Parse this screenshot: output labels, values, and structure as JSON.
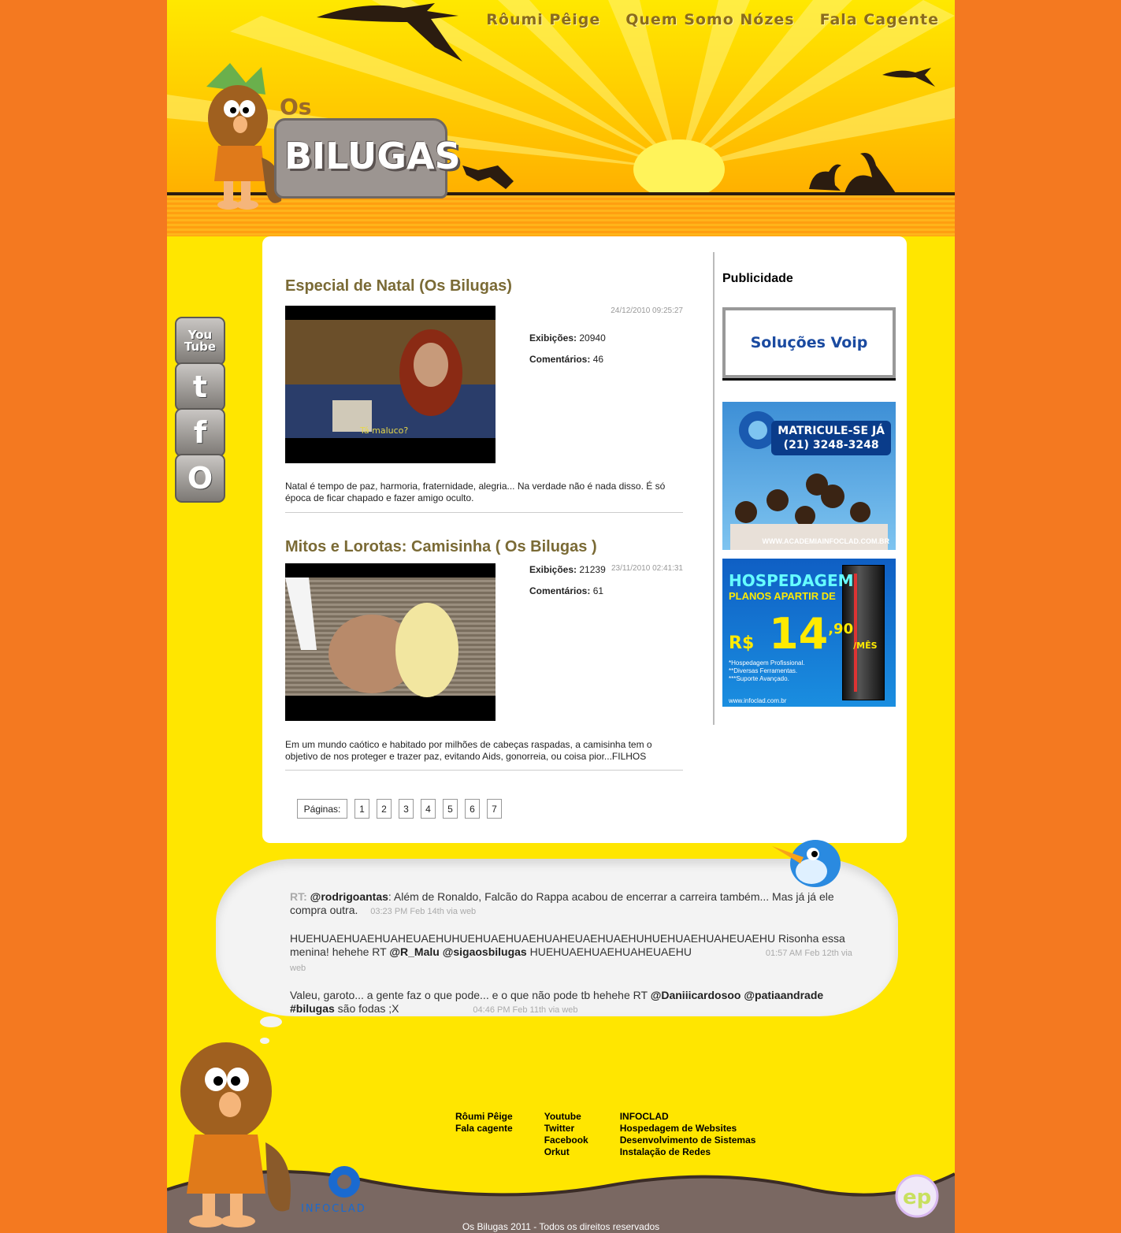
{
  "nav": [
    "Rôumi Pêige",
    "Quem Somo Nózes",
    "Fala Cagente"
  ],
  "logo": {
    "prefix": "Os",
    "name": "BILUGAS"
  },
  "social": [
    "YouTube",
    "Twitter",
    "Facebook",
    "Orkut"
  ],
  "posts": [
    {
      "title": "Especial de Natal (Os Bilugas)",
      "date": "24/12/2010 09:25:27",
      "views_label": "Exibições:",
      "views": "20940",
      "comments_label": "Comentários:",
      "comments": "46",
      "thumb_caption": "Tá maluco?",
      "description": "Natal é tempo de paz, harmoria, fraternidade, alegria... Na verdade não é nada disso. É só época de ficar chapado e fazer amigo oculto."
    },
    {
      "title": "Mitos e Lorotas: Camisinha ( Os Bilugas )",
      "date": "23/11/2010 02:41:31",
      "views_label": "Exibições:",
      "views": "21239",
      "comments_label": "Comentários:",
      "comments": "61",
      "description": "Em um mundo caótico e habitado por milhões de cabeças raspadas, a camisinha tem o objetivo de nos proteger e trazer paz, evitando Aids, gonorreia, ou coisa pior...FILHOS"
    }
  ],
  "pagination": {
    "label": "Páginas:",
    "pages": [
      "1",
      "2",
      "3",
      "4",
      "5",
      "6",
      "7"
    ]
  },
  "sidebar": {
    "title": "Publicidade",
    "voip": "Soluções Voip",
    "infoclad": {
      "line1": "MATRICULE-SE JÁ",
      "line2": "(21) 3248-3248",
      "url": "WWW.ACADEMIAINFOCLAD.COM.BR"
    },
    "host": {
      "title": "HOSPEDAGEM",
      "subtitle": "PLANOS APARTIR DE",
      "currency": "R$",
      "price": "14",
      "cents": ",90",
      "per": "/MÊS",
      "features": [
        "*Hospedagem Profissional.",
        "**Diversas Ferramentas.",
        "***Suporte Avançado."
      ],
      "url": "www.infoclad.com.br"
    }
  },
  "tweets": [
    {
      "prefix": "RT:",
      "user": "@rodrigoantas",
      "text": ": Além de Ronaldo, Falcão do Rappa acabou de encerrar a carreira também... Mas já já ele compra outra.",
      "meta": "03:23 PM Feb 14th via web"
    },
    {
      "text_before": "HUEHUAEHUAEHUAHEUAEHUHUEHUAEHUAEHUAHEUAEHUAEHUHUEHUAEHUAHEUAEHU Risonha essa menina! hehehe RT",
      "user1": "@R_Malu",
      "user2": "@sigaosbilugas",
      "text_after": " HUEHUAEHUAEHUAHEUAEHU",
      "meta": "01:57 AM Feb 12th via web"
    },
    {
      "text_before": "Valeu, garoto... a gente faz o que pode... e o que não pode tb hehehe RT",
      "user1": "@Daniiicardosoo",
      "user2": "@patiaandrade",
      "hashtag": "#bilugas",
      "text_after": " são fodas ;X",
      "meta": "04:46 PM Feb 11th via web"
    }
  ],
  "footer": {
    "col1": [
      "Rôumi Pêige",
      "Fala cagente"
    ],
    "col2": [
      "Youtube",
      "Twitter",
      "Facebook",
      "Orkut"
    ],
    "col3": [
      "INFOCLAD",
      "Hospedagem de Websites",
      "Desenvolvimento de Sistemas",
      "Instalação de Redes"
    ],
    "infoclad_logo": "INFOCLAD",
    "ep_logo": "ep",
    "copyright": "Os Bilugas 2011 - Todos os direitos reservados"
  },
  "colors": {
    "outer": "#f47920",
    "page": "#ffe600",
    "title": "#7a6a35"
  }
}
